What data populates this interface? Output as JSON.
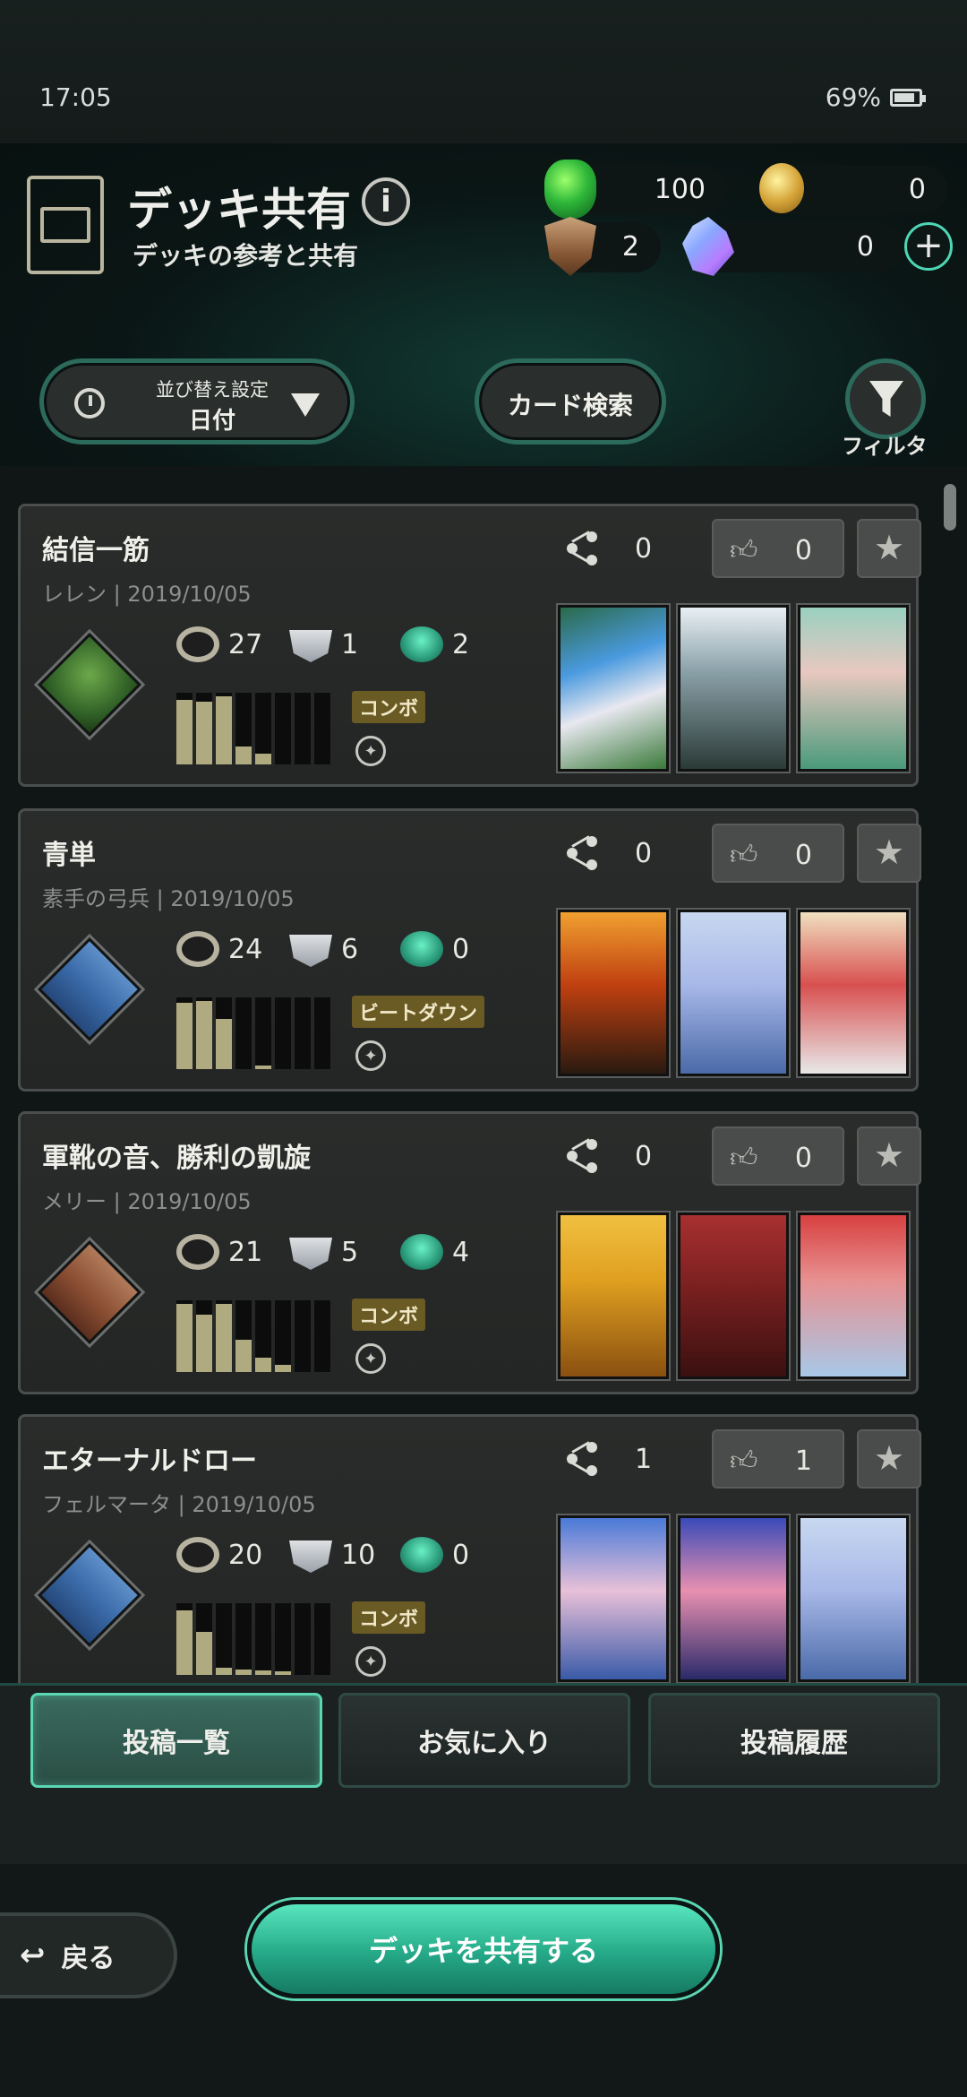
{
  "status": {
    "time": "17:05",
    "battery": "69%"
  },
  "header": {
    "title": "デッキ共有",
    "info": "i",
    "subtitle": "デッキの参考と共有"
  },
  "currencies": {
    "gem": "100",
    "coin": "0",
    "shield": "2",
    "crystal": "0"
  },
  "controls": {
    "sort_label": "並び替え設定",
    "sort_value": "日付",
    "card_search": "カード検索",
    "filter_label": "フィルタ"
  },
  "decks": [
    {
      "name": "結信一筋",
      "author": "レレン",
      "date": "2019/10/05",
      "shares": "0",
      "likes": "0",
      "followers": "27",
      "spells": "1",
      "amulets": "2",
      "tag": "コンボ",
      "curve": [
        0.9,
        0.88,
        0.95,
        0.25,
        0.15,
        0,
        0,
        0
      ],
      "leader": "green",
      "arts": [
        "linear-gradient(160deg,#2a6a4a 0%,#4a9adf 35%,#e8e8f0 60%,#3a7a3a 100%)",
        "linear-gradient(180deg,#e8f0f4 0%,#8aa0a8 40%,#2a3a36 100%)",
        "linear-gradient(180deg,#9ad0c0 0%,#e8c8c0 40%,#4a9a7a 100%)"
      ]
    },
    {
      "name": "青単",
      "author": "素手の弓兵",
      "date": "2019/10/05",
      "shares": "0",
      "likes": "0",
      "followers": "24",
      "spells": "6",
      "amulets": "0",
      "tag": "ビートダウン",
      "curve": [
        0.92,
        0.95,
        0.7,
        0,
        0.05,
        0,
        0,
        0
      ],
      "leader": "blue",
      "arts": [
        "linear-gradient(180deg,#f0a030 0%,#c04010 45%,#2a1a10 100%)",
        "linear-gradient(180deg,#c8d8f0 0%,#a8b8e8 45%,#4a6aa8 100%)",
        "linear-gradient(180deg,#f0e0c0 0%,#d85050 45%,#e8e8e8 100%)"
      ]
    },
    {
      "name": "軍靴の音、勝利の凱旋",
      "author": "メリー",
      "date": "2019/10/05",
      "shares": "0",
      "likes": "0",
      "followers": "21",
      "spells": "5",
      "amulets": "4",
      "tag": "コンボ",
      "curve": [
        0.95,
        0.8,
        0.95,
        0.45,
        0.2,
        0.1,
        0,
        0
      ],
      "leader": "red",
      "arts": [
        "linear-gradient(180deg,#f0c040 0%,#e0a020 40%,#8a5010 100%)",
        "linear-gradient(180deg,#a83030 0%,#7a2020 45%,#3a1010 100%)",
        "linear-gradient(180deg,#d84040 0%,#e89090 40%,#a8c8e8 100%)"
      ]
    },
    {
      "name": "エターナルドロー",
      "author": "フェルマータ",
      "date": "2019/10/05",
      "shares": "1",
      "likes": "1",
      "followers": "20",
      "spells": "10",
      "amulets": "0",
      "tag": "コンボ",
      "curve": [
        0.9,
        0.6,
        0.1,
        0.08,
        0.06,
        0.05,
        0,
        0
      ],
      "leader": "blue",
      "arts": [
        "linear-gradient(180deg,#4a7ad8 0%,#e8c0d8 45%,#3a5aa8 100%)",
        "linear-gradient(180deg,#3a4ab8 0%,#e890b0 45%,#2a2a6a 100%)",
        "linear-gradient(180deg,#c8d8f0 0%,#a8b8e8 45%,#4a6aa8 100%)"
      ]
    }
  ],
  "tabs": [
    "投稿一覧",
    "お気に入り",
    "投稿履歴"
  ],
  "footer": {
    "back": "戻る",
    "share_deck": "デッキを共有する"
  }
}
